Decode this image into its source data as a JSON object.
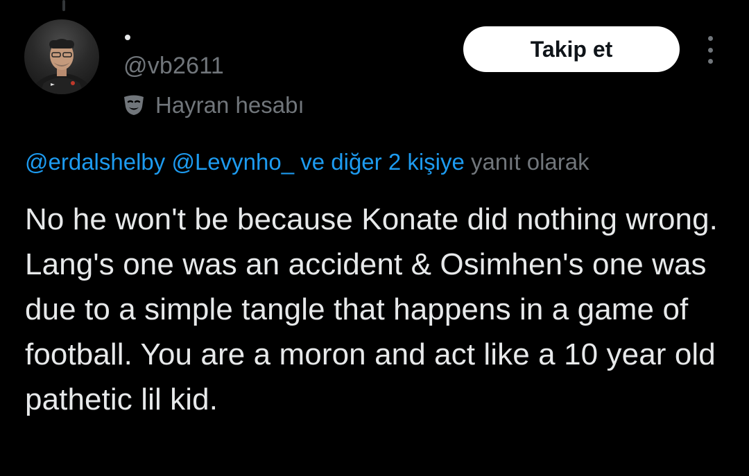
{
  "user": {
    "handle": "@vb2611",
    "badge_label": "Hayran hesabı",
    "badge_icon": "theater-masks-icon",
    "avatar_icon": "profile-photo-avatar"
  },
  "header": {
    "follow_label": "Takip et",
    "more_icon": "more-vertical-icon"
  },
  "reply": {
    "mentions": [
      "@erdalshelby",
      "@Levynho_"
    ],
    "others": "ve diğer 2 kişiye",
    "suffix": "yanıt olarak"
  },
  "tweet": {
    "text": "No he won't be because Konate did nothing wrong. Lang's one was an accident & Osimhen's one was due to a simple tangle that happens in a game of football. You are a moron and act like a 10 year old pathetic lil kid."
  },
  "colors": {
    "background": "#000000",
    "text_primary": "#e7e9ea",
    "text_secondary": "#71767b",
    "link": "#1d9bf0",
    "button_bg": "#ffffff",
    "button_text": "#0f1419"
  }
}
